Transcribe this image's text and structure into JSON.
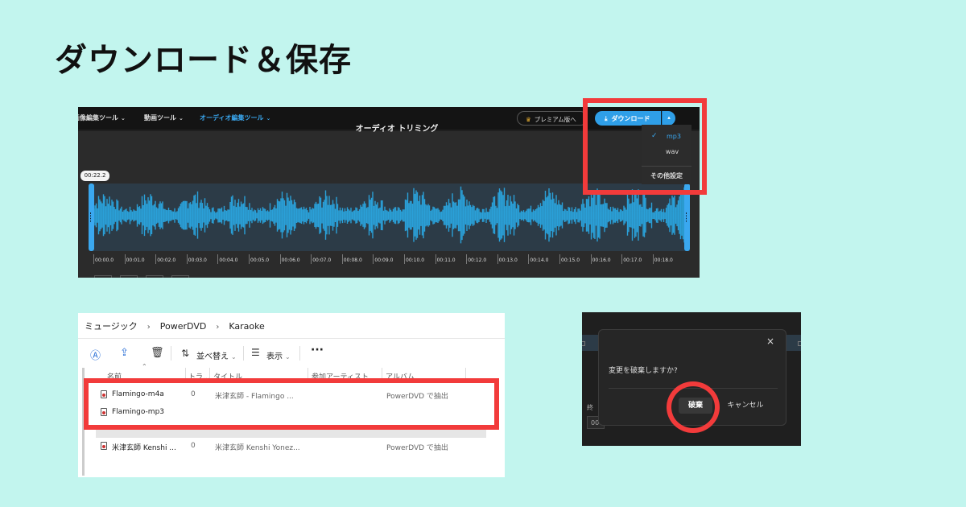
{
  "page_title": "ダウンロード＆保存",
  "editor": {
    "nav": [
      {
        "label": "画像編集ツール",
        "active": false
      },
      {
        "label": "動画ツール",
        "active": false
      },
      {
        "label": "オーディオ編集ツール",
        "active": true
      }
    ],
    "nav_chevron": "⌄",
    "premium_label": "プレミアム版へ",
    "download_label": "ダウンロード",
    "download_caret": "▴",
    "trim_title": "オーディオ トリミング",
    "current_time": "00:22.2",
    "ticks": [
      "00:00.0",
      "00:01.0",
      "00:02.0",
      "00:03.0",
      "00:04.0",
      "00:05.0",
      "00:06.0",
      "00:07.0",
      "00:08.0",
      "00:09.0",
      "00:10.0",
      "00:11.0",
      "00:12.0",
      "00:13.0",
      "00:14.0",
      "00:15.0",
      "00:16.0",
      "00:17.0",
      "00:18.0"
    ],
    "formats": [
      {
        "label": "mp3",
        "selected": true
      },
      {
        "label": "wav",
        "selected": false
      }
    ],
    "check_mark": "✓",
    "other_settings": "その他設定",
    "colors": {
      "accent": "#3aa8f0",
      "waveform": "#2aa0d8",
      "highlight": "#f23b3b"
    }
  },
  "explorer": {
    "breadcrumb": [
      "ミュージック",
      "PowerDVD",
      "Karaoke"
    ],
    "breadcrumb_sep": "›",
    "toolbar": {
      "sort_label": "並べ替え",
      "view_label": "表示",
      "more": "···",
      "chevron": "⌄"
    },
    "columns": [
      "名前",
      "トラ...",
      "タイトル",
      "参加アーティスト",
      "アルバム"
    ],
    "rows": [
      {
        "name": "Flamingo-m4a",
        "track": "0",
        "title": "米津玄師 - Flamingo ...",
        "album": "PowerDVD で抽出"
      },
      {
        "name": "Flamingo-mp3",
        "track": "",
        "title": "",
        "album": ""
      },
      {
        "name": "米津玄師  Kenshi ...",
        "track": "0",
        "title": "米津玄師  Kenshi Yonez...",
        "album": "PowerDVD で抽出"
      }
    ]
  },
  "dialog": {
    "message": "変更を破棄しますか?",
    "discard_label": "破棄",
    "cancel_label": "キャンセル",
    "close_icon": "×",
    "bg_label": "終",
    "bg_field": "00"
  }
}
